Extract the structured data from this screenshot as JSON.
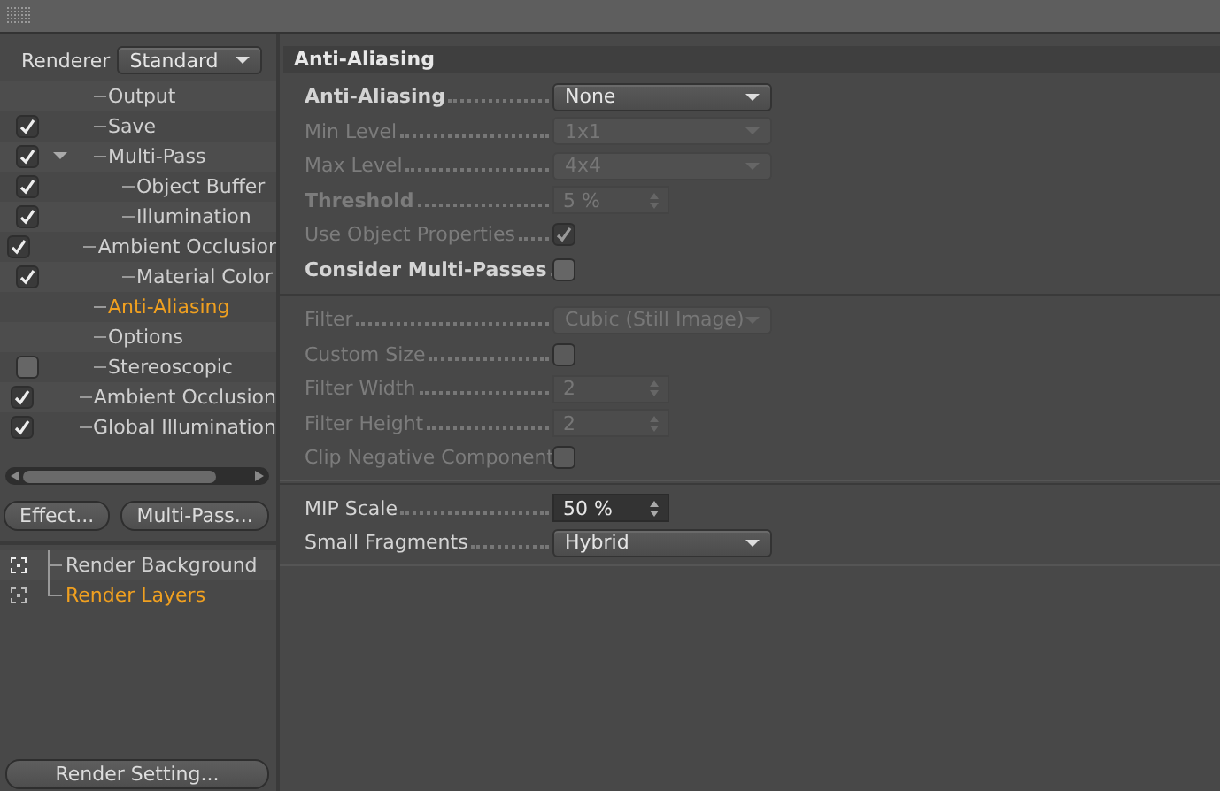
{
  "renderer": {
    "label": "Renderer",
    "value": "Standard"
  },
  "tree": [
    {
      "label": "Output",
      "selected": false
    },
    {
      "label": "Save",
      "selected": false,
      "checked": true
    },
    {
      "label": "Multi-Pass",
      "selected": false,
      "checked": true,
      "expanded": true,
      "children": [
        {
          "label": "Object Buffer",
          "selected": false,
          "checked": true
        },
        {
          "label": "Illumination",
          "selected": false,
          "checked": true
        },
        {
          "label": "Ambient Occlusior",
          "selected": false,
          "checked": true
        },
        {
          "label": "Material Color",
          "selected": false,
          "checked": true
        }
      ]
    },
    {
      "label": "Anti-Aliasing",
      "selected": true
    },
    {
      "label": "Options",
      "selected": false
    },
    {
      "label": "Stereoscopic",
      "selected": false,
      "checked": false
    },
    {
      "label": "Ambient Occlusion",
      "selected": false,
      "checked": true
    },
    {
      "label": "Global Illumination",
      "selected": false,
      "checked": true
    }
  ],
  "buttons": [
    "Effect...",
    "Multi-Pass..."
  ],
  "layers": [
    {
      "label": "Render Background",
      "selected": false
    },
    {
      "label": "Render Layers",
      "selected": true
    }
  ],
  "footer_button": "Render Setting...",
  "section_title": "Anti-Aliasing",
  "groups": [
    [
      {
        "label": "Anti-Aliasing",
        "kind": "dropdown",
        "value": "None",
        "disabled": false,
        "bold": true
      },
      {
        "label": "Min Level",
        "kind": "dropdown",
        "value": "1x1",
        "disabled": true,
        "bold": false
      },
      {
        "label": "Max Level",
        "kind": "dropdown",
        "value": "4x4",
        "disabled": true,
        "bold": false
      },
      {
        "label": "Threshold",
        "kind": "spinner",
        "value": "5 %",
        "disabled": true,
        "bold": true
      },
      {
        "label": "Use Object Properties",
        "kind": "checkbox",
        "checked": true,
        "disabled": true,
        "bold": false
      },
      {
        "label": "Consider Multi-Passes",
        "kind": "checkbox",
        "checked": false,
        "disabled": false,
        "bold": true
      }
    ],
    [
      {
        "label": "Filter",
        "kind": "dropdown",
        "value": "Cubic (Still Image)",
        "disabled": true,
        "bold": false
      },
      {
        "label": "Custom Size",
        "kind": "checkbox",
        "checked": false,
        "disabled": true,
        "bold": false
      },
      {
        "label": "Filter Width",
        "kind": "spinner",
        "value": "2",
        "disabled": true,
        "bold": false
      },
      {
        "label": "Filter Height",
        "kind": "spinner",
        "value": "2",
        "disabled": true,
        "bold": false
      },
      {
        "label": "Clip Negative Component",
        "kind": "checkbox",
        "checked": false,
        "disabled": true,
        "bold": false
      }
    ],
    [
      {
        "label": "MIP Scale",
        "kind": "spinner",
        "value": "50 %",
        "disabled": false,
        "bold": false
      },
      {
        "label": "Small Fragments",
        "kind": "dropdown",
        "value": "Hybrid",
        "disabled": false,
        "bold": false
      }
    ]
  ]
}
